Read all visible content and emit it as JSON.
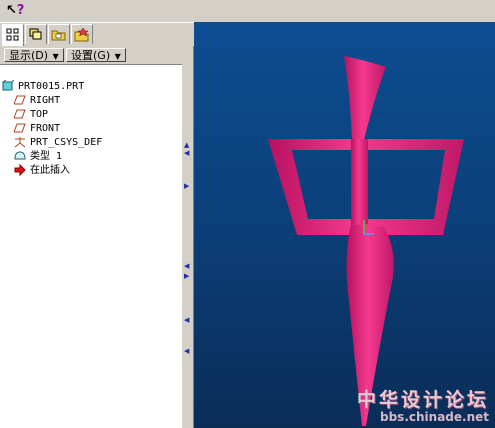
{
  "toolbar": {
    "whats_this_icon": "whats-this-icon"
  },
  "tabs": [
    {
      "name": "model-tree-tab",
      "icon": "tree-icon",
      "active": true
    },
    {
      "name": "layers-tab",
      "icon": "layers-icon",
      "active": false
    },
    {
      "name": "folder-tab",
      "icon": "folder-icon",
      "active": false
    },
    {
      "name": "favorites-tab",
      "icon": "favorites-icon",
      "active": false
    }
  ],
  "panel": {
    "show_label": "显示(D)",
    "settings_label": "设置(G)"
  },
  "tree": {
    "root": "PRT0015.PRT",
    "items": [
      {
        "label": "RIGHT",
        "icon": "datum-plane-icon"
      },
      {
        "label": "TOP",
        "icon": "datum-plane-icon"
      },
      {
        "label": "FRONT",
        "icon": "datum-plane-icon"
      },
      {
        "label": "PRT_CSYS_DEF",
        "icon": "csys-icon"
      },
      {
        "label": "类型 1",
        "icon": "feature-icon"
      },
      {
        "label": "在此插入",
        "icon": "insert-here-arrow-icon"
      }
    ]
  },
  "viewport": {
    "model_color": "#ee2a80",
    "watermark_line1": "中华设计论坛",
    "watermark_line2": "bbs.chinade.net"
  }
}
